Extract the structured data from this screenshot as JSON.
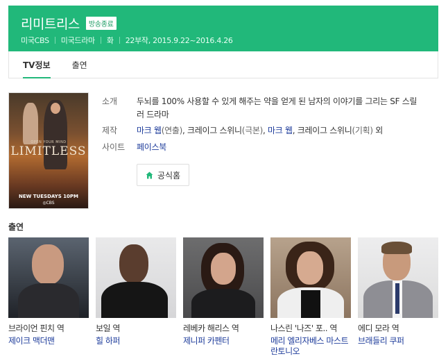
{
  "header": {
    "title": "리미트리스",
    "badge": "방송종료",
    "meta": [
      "미국CBS",
      "미국드라마",
      "화",
      "22부작, 2015.9.22~2016.4.26"
    ],
    "accent_color": "#21b87a"
  },
  "tabs": [
    {
      "label": "TV정보",
      "active": true
    },
    {
      "label": "출연",
      "active": false
    }
  ],
  "poster": {
    "small_text": "OPEN YOUR MIND",
    "title": "LIMITLESS",
    "footer": "NEW TUESDAYS 10PM",
    "network": "◎CBS"
  },
  "info": {
    "intro_label": "소개",
    "intro_text": "두뇌를 100% 사용할 수 있게 해주는 약을 얻게 된 남자의 이야기를 그리는 SF 스릴러 드라마",
    "production_label": "제작",
    "production": {
      "person1": "마크 웹",
      "role1": "(연출)",
      "sep1": ", 크레이그 스위니",
      "role2": "(극본)",
      "sep2": ", ",
      "person3": "마크 웹",
      "sep3": ", 크레이그 스위니",
      "role4": "(기획)",
      "tail": " 외"
    },
    "site_label": "사이트",
    "site_link": "페이스북",
    "home_button": "공식홈"
  },
  "cast_heading": "출연",
  "cast": [
    {
      "role": "브라이언 핀치 역",
      "name": "제이크 맥더맨"
    },
    {
      "role": "보일 역",
      "name": "힐 하퍼"
    },
    {
      "role": "레베카 해리스 역",
      "name": "제니퍼 카펜터"
    },
    {
      "role": "나스린 '나즈' 포.. 역",
      "name": "메리 엘리자베스 마스트란토니오"
    },
    {
      "role": "에디 모라 역",
      "name": "브래들리 쿠퍼"
    }
  ]
}
